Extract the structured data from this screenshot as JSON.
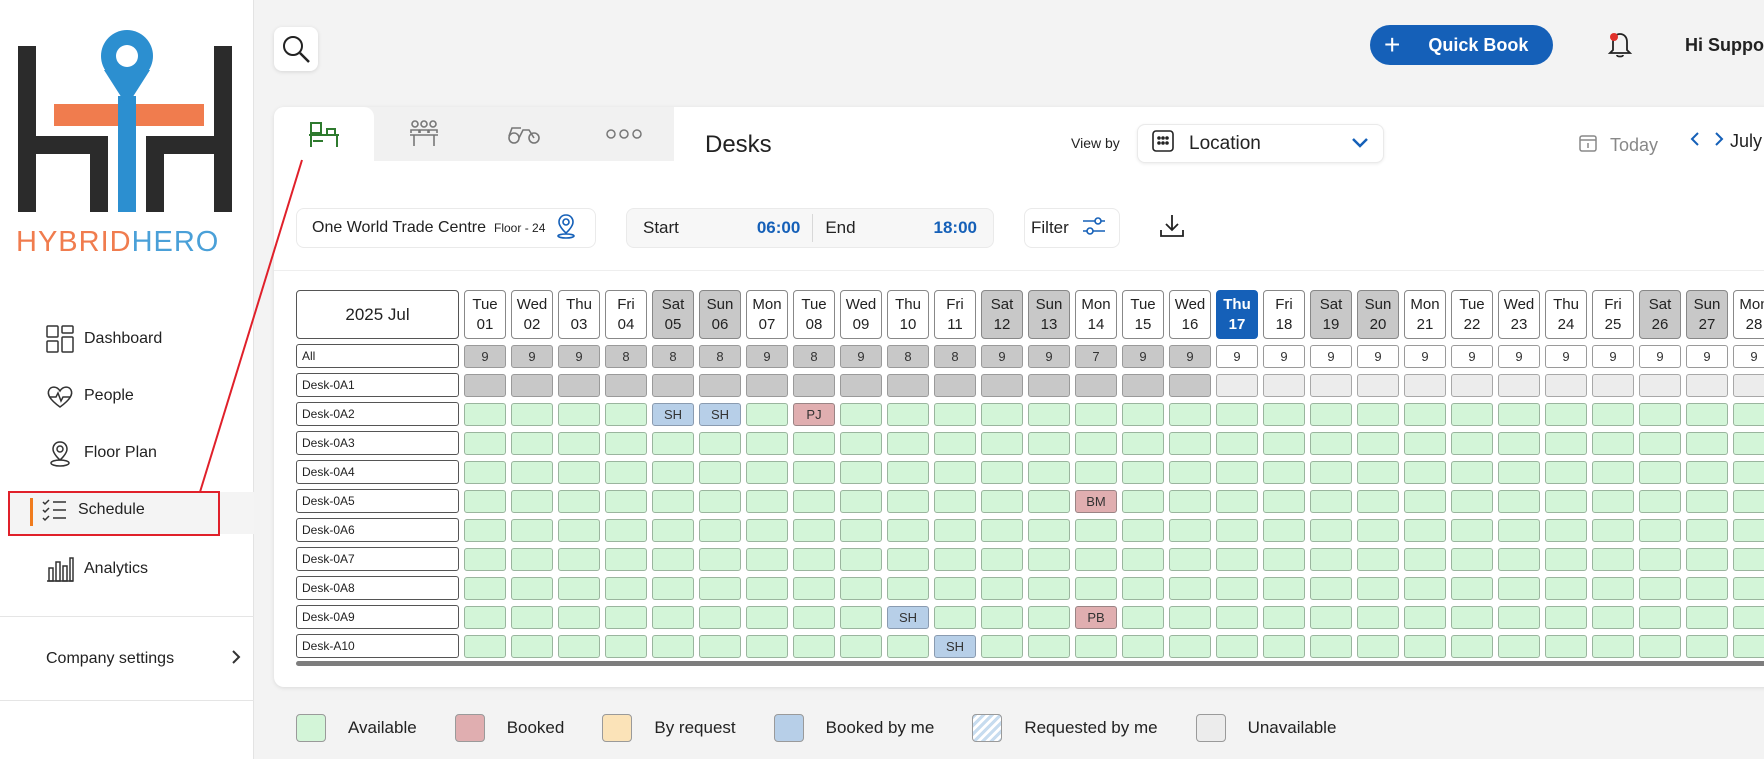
{
  "brand": {
    "logo_text_part1": "HYBRID",
    "logo_text_part2": "HERO"
  },
  "sidebar": {
    "items": [
      {
        "label": "Dashboard",
        "icon": "dashboard-icon"
      },
      {
        "label": "People",
        "icon": "people-icon"
      },
      {
        "label": "Floor Plan",
        "icon": "location-pin-icon"
      },
      {
        "label": "Schedule",
        "icon": "schedule-icon",
        "active": true
      },
      {
        "label": "Analytics",
        "icon": "analytics-icon"
      }
    ],
    "company_settings": "Company settings"
  },
  "topbar": {
    "quick_book": "Quick Book",
    "greeting": "Hi Suppor"
  },
  "panel": {
    "tabs": [
      "desk-icon",
      "meeting-room-icon",
      "parking-icon",
      "more-icon"
    ],
    "title": "Desks",
    "view_by_label": "View by",
    "view_by_value": "Location",
    "today_label": "Today",
    "month_label": "July",
    "location": "One World Trade Centre",
    "floor": "Floor - 24",
    "start_label": "Start",
    "start_value": "06:00",
    "end_label": "End",
    "end_value": "18:00",
    "filter_label": "Filter"
  },
  "grid": {
    "month_header": "2025 Jul",
    "days": [
      {
        "dow": "Tue",
        "d": "01",
        "count": "9"
      },
      {
        "dow": "Wed",
        "d": "02",
        "count": "9"
      },
      {
        "dow": "Thu",
        "d": "03",
        "count": "9"
      },
      {
        "dow": "Fri",
        "d": "04",
        "count": "8"
      },
      {
        "dow": "Sat",
        "d": "05",
        "count": "8",
        "weekend": true
      },
      {
        "dow": "Sun",
        "d": "06",
        "count": "8",
        "weekend": true
      },
      {
        "dow": "Mon",
        "d": "07",
        "count": "9"
      },
      {
        "dow": "Tue",
        "d": "08",
        "count": "8"
      },
      {
        "dow": "Wed",
        "d": "09",
        "count": "9"
      },
      {
        "dow": "Thu",
        "d": "10",
        "count": "8"
      },
      {
        "dow": "Fri",
        "d": "11",
        "count": "8"
      },
      {
        "dow": "Sat",
        "d": "12",
        "count": "9",
        "weekend": true
      },
      {
        "dow": "Sun",
        "d": "13",
        "count": "9",
        "weekend": true
      },
      {
        "dow": "Mon",
        "d": "14",
        "count": "7"
      },
      {
        "dow": "Tue",
        "d": "15",
        "count": "9"
      },
      {
        "dow": "Wed",
        "d": "16",
        "count": "9"
      },
      {
        "dow": "Thu",
        "d": "17",
        "count": "9",
        "today": true
      },
      {
        "dow": "Fri",
        "d": "18",
        "count": "9"
      },
      {
        "dow": "Sat",
        "d": "19",
        "count": "9",
        "weekend": true
      },
      {
        "dow": "Sun",
        "d": "20",
        "count": "9",
        "weekend": true
      },
      {
        "dow": "Mon",
        "d": "21",
        "count": "9"
      },
      {
        "dow": "Tue",
        "d": "22",
        "count": "9"
      },
      {
        "dow": "Wed",
        "d": "23",
        "count": "9"
      },
      {
        "dow": "Thu",
        "d": "24",
        "count": "9"
      },
      {
        "dow": "Fri",
        "d": "25",
        "count": "9"
      },
      {
        "dow": "Sat",
        "d": "26",
        "count": "9",
        "weekend": true
      },
      {
        "dow": "Sun",
        "d": "27",
        "count": "9",
        "weekend": true
      },
      {
        "dow": "Mon",
        "d": "28",
        "count": "9"
      }
    ],
    "all_label": "All",
    "rows": [
      {
        "name": "Desk-0A1",
        "bookings": {},
        "unavailable": true
      },
      {
        "name": "Desk-0A2",
        "bookings": {
          "5": [
            "SH",
            "mine"
          ],
          "6": [
            "SH",
            "mine"
          ],
          "8": [
            "PJ",
            "booked"
          ]
        }
      },
      {
        "name": "Desk-0A3",
        "bookings": {}
      },
      {
        "name": "Desk-0A4",
        "bookings": {}
      },
      {
        "name": "Desk-0A5",
        "bookings": {
          "14": [
            "BM",
            "booked"
          ]
        }
      },
      {
        "name": "Desk-0A6",
        "bookings": {}
      },
      {
        "name": "Desk-0A7",
        "bookings": {}
      },
      {
        "name": "Desk-0A8",
        "bookings": {}
      },
      {
        "name": "Desk-0A9",
        "bookings": {
          "10": [
            "SH",
            "mine"
          ],
          "14": [
            "PB",
            "booked"
          ]
        }
      },
      {
        "name": "Desk-A10",
        "bookings": {
          "11": [
            "SH",
            "mine"
          ]
        }
      }
    ]
  },
  "legend": [
    {
      "label": "Available",
      "color": "#d3f5d8"
    },
    {
      "label": "Booked",
      "color": "#e0aeb0"
    },
    {
      "label": "By request",
      "color": "#fbe3b8"
    },
    {
      "label": "Booked by me",
      "color": "#b7cfe8"
    },
    {
      "label": "Requested by me",
      "color": "hatched"
    },
    {
      "label": "Unavailable",
      "color": "#ececec"
    }
  ],
  "colors": {
    "primary": "#1560b8",
    "accent": "#f07c1e",
    "annotation": "#e0202a"
  }
}
